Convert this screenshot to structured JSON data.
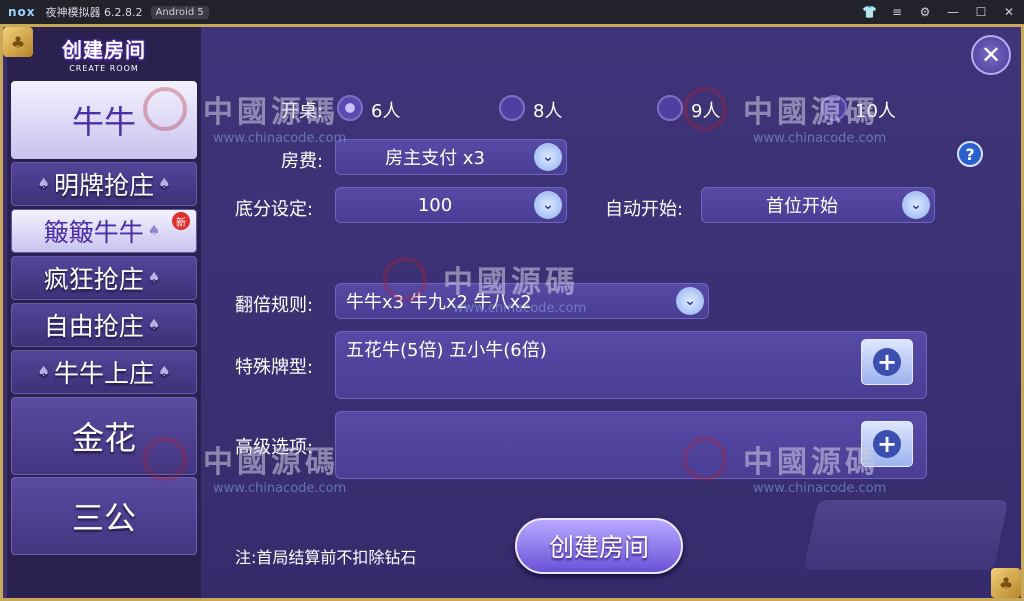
{
  "emulator": {
    "logo": "nox",
    "title": "夜神模拟器 6.2.8.2",
    "android_badge": "Android 5",
    "icons": [
      "shirt-icon",
      "menu-icon",
      "settings-icon",
      "minimize-icon",
      "maximize-icon",
      "close-icon"
    ],
    "icon_glyphs": [
      "👕",
      "≡",
      "⚙",
      "—",
      "☐",
      "✕"
    ]
  },
  "brand": {
    "title": "创建房间",
    "subtitle": "CREATE ROOM"
  },
  "sidebar": {
    "top": {
      "label": "牛牛"
    },
    "subs": [
      {
        "label": "明牌抢庄"
      },
      {
        "label": "簸簸牛牛",
        "badge": "新"
      },
      {
        "label": "疯狂抢庄"
      },
      {
        "label": "自由抢庄"
      },
      {
        "label": "牛牛上庄"
      }
    ],
    "bottom": [
      {
        "label": "金花"
      },
      {
        "label": "三公"
      }
    ]
  },
  "form": {
    "tables": {
      "label": "开桌:",
      "options": [
        "6人",
        "8人",
        "9人",
        "10人"
      ],
      "selected": "6人"
    },
    "fee": {
      "label": "房费:",
      "value": "房主支付 x3"
    },
    "base": {
      "label": "底分设定:",
      "value": "100"
    },
    "auto_start": {
      "label": "自动开始:",
      "value": "首位开始"
    },
    "multiplier": {
      "label": "翻倍规则:",
      "value": "牛牛x3  牛九x2  牛八x2"
    },
    "special": {
      "label": "特殊牌型:",
      "value": "五花牛(5倍)  五小牛(6倍)"
    },
    "advanced": {
      "label": "高级选项:",
      "value": ""
    }
  },
  "note": "注:首局结算前不扣除钻石",
  "create_button": "创建房间",
  "close_glyph": "✕",
  "help_glyph": "?",
  "plus_glyph": "+",
  "chevron_glyph": "⌄",
  "suit_glyph": "♠",
  "corner_glyph": "♣",
  "watermark": {
    "text": "中國源碼",
    "url": "www.chinacode.com"
  },
  "colors": {
    "frame": "#c9a85a",
    "panel": "#3a2f6e",
    "accent": "#6b52d8"
  }
}
